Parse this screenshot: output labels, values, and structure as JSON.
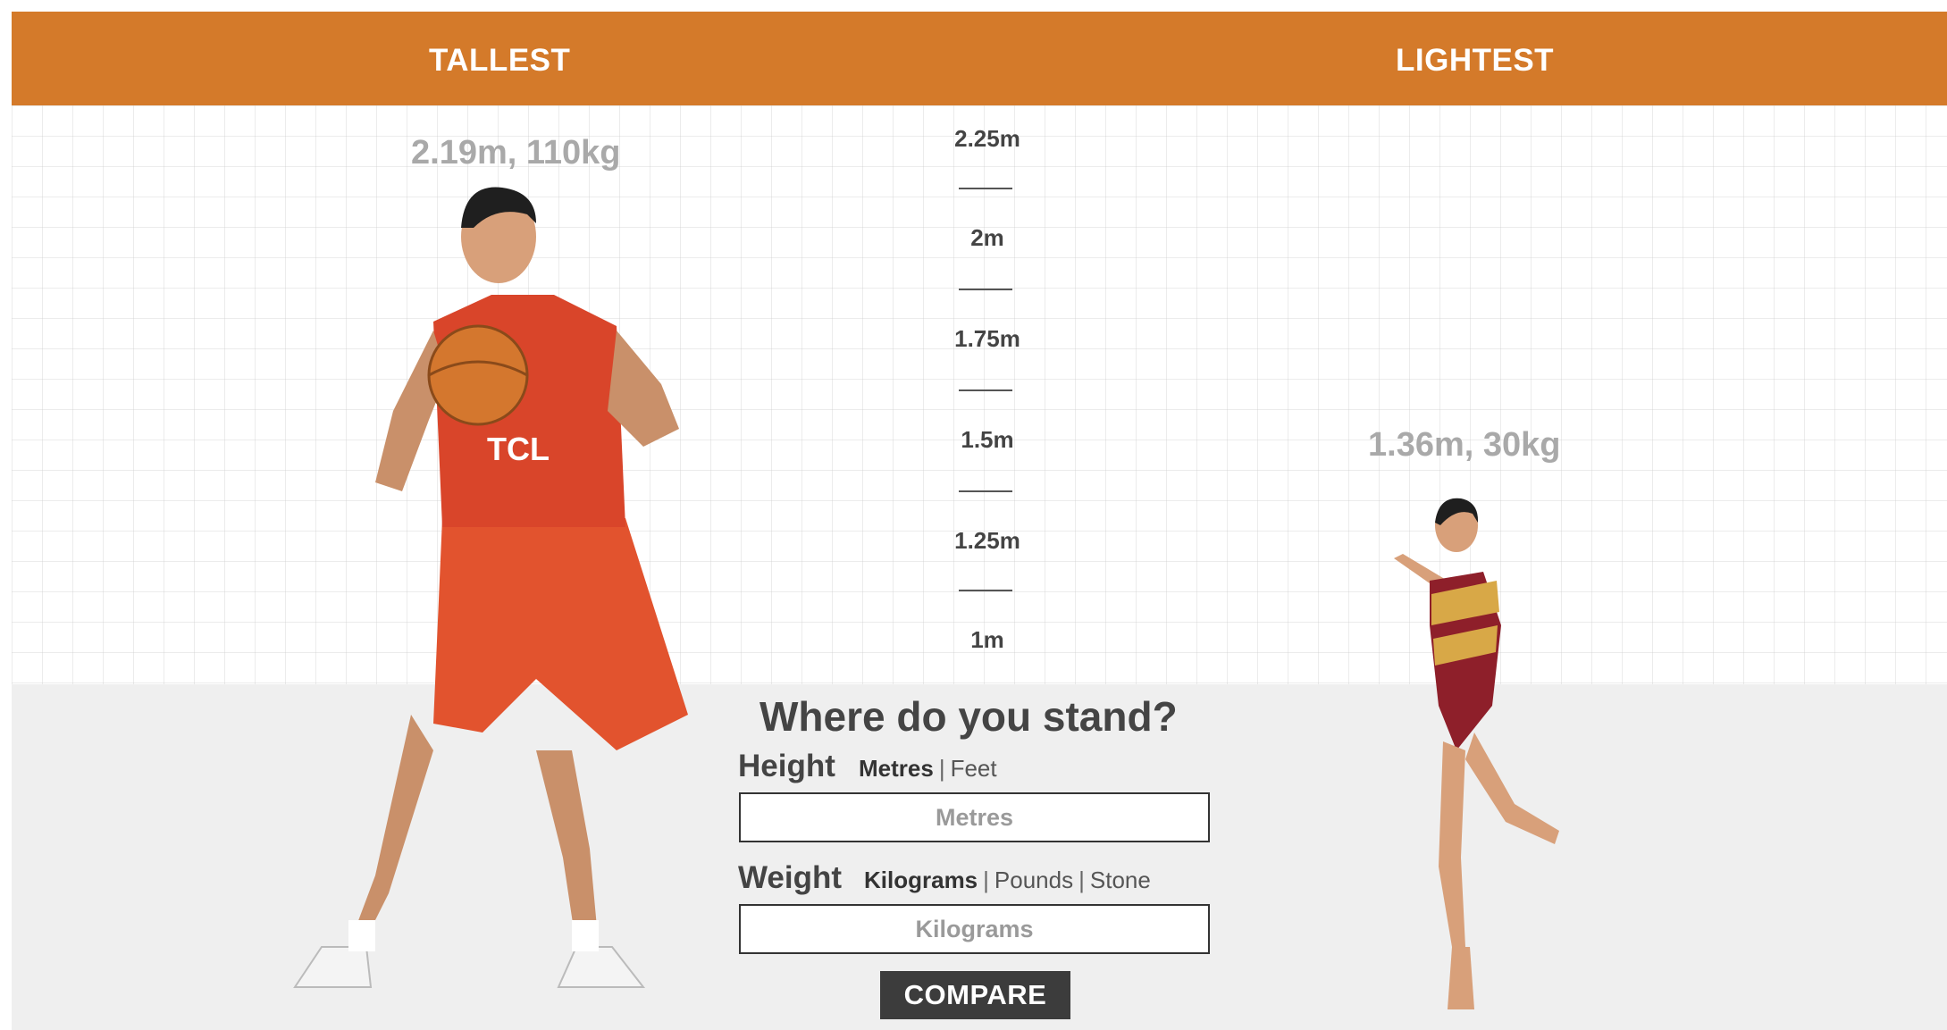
{
  "header": {
    "left_title": "TALLEST",
    "right_title": "LIGHTEST",
    "color": "#d47a2a"
  },
  "tallest": {
    "stats": "2.19m, 110kg",
    "icon": "basketball-player-figure"
  },
  "lightest": {
    "stats": "1.36m, 30kg",
    "icon": "gymnast-figure"
  },
  "scale": {
    "labels": [
      "2.25m",
      "2m",
      "1.75m",
      "1.5m",
      "1.25m",
      "1m"
    ]
  },
  "form": {
    "title": "Where do you stand?",
    "height": {
      "label": "Height",
      "units": [
        "Metres",
        "Feet"
      ],
      "active_unit": "Metres",
      "separator": "|",
      "placeholder": "Metres",
      "value": ""
    },
    "weight": {
      "label": "Weight",
      "units": [
        "Kilograms",
        "Pounds",
        "Stone"
      ],
      "active_unit": "Kilograms",
      "separator": "|",
      "placeholder": "Kilograms",
      "value": ""
    },
    "compare_label": "COMPARE"
  }
}
